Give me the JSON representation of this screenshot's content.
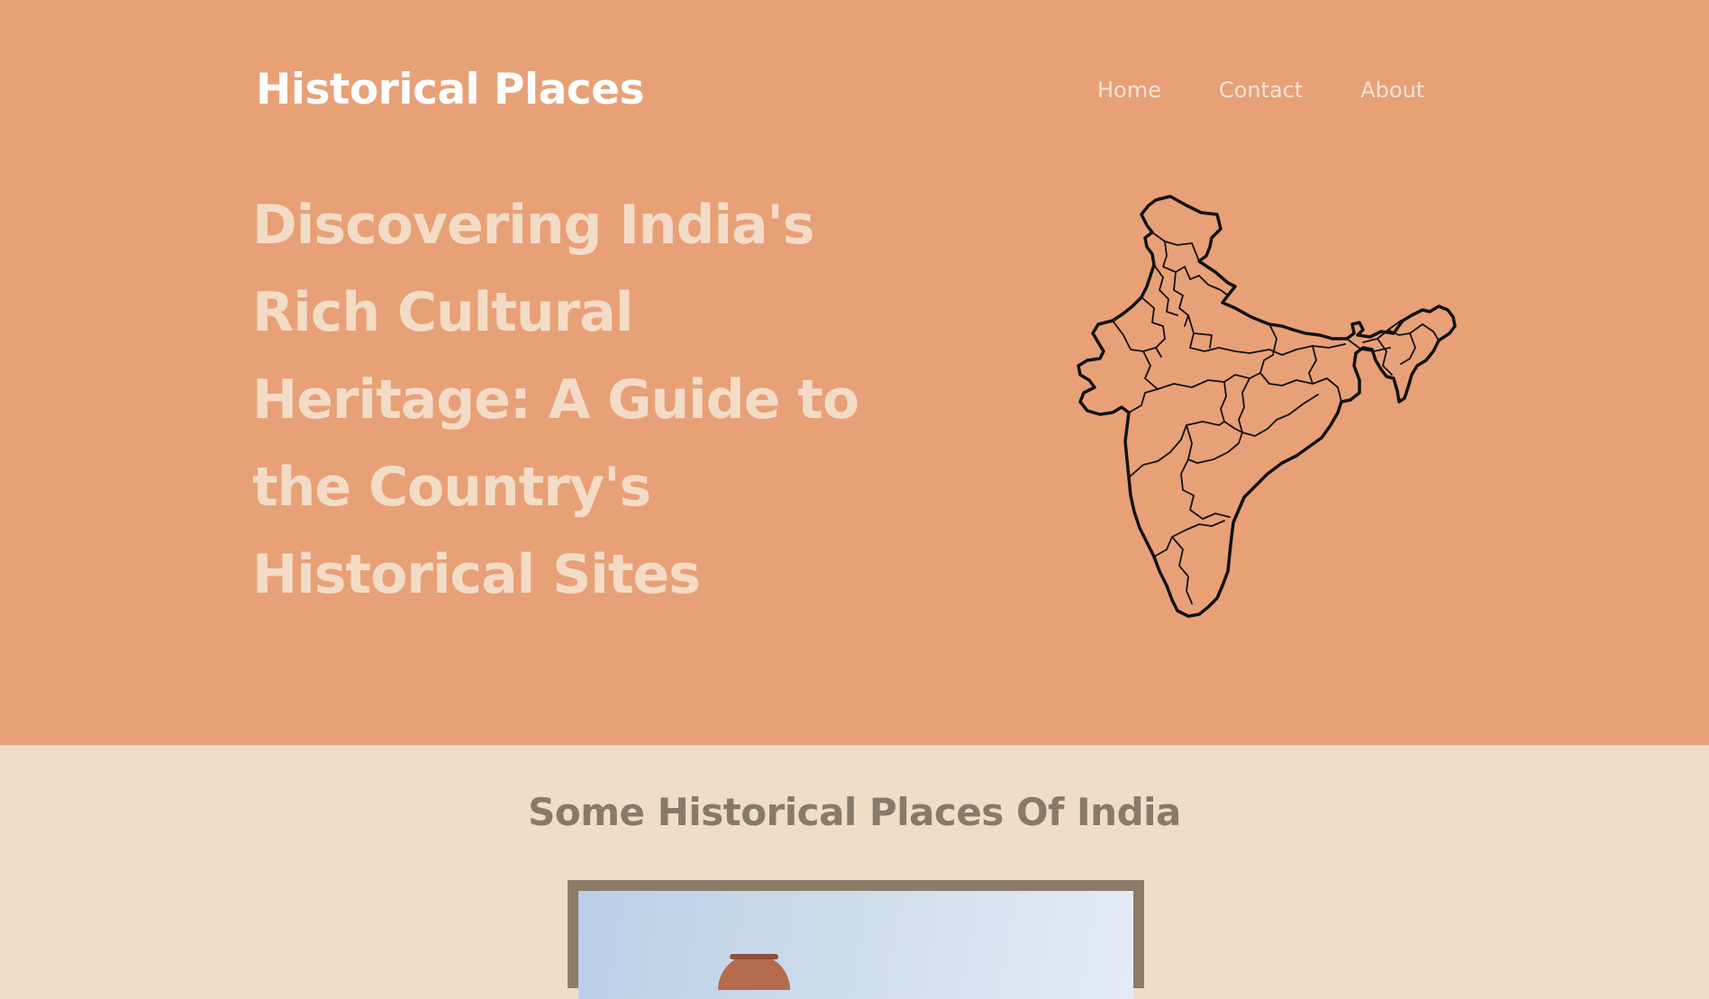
{
  "header": {
    "brand": "Historical Places",
    "nav": [
      {
        "label": "Home"
      },
      {
        "label": "Contact"
      },
      {
        "label": "About"
      }
    ]
  },
  "hero": {
    "headline": "Discovering India's Rich Cultural Heritage: A Guide to the Country's Historical Sites",
    "map_icon": "india-map-outline"
  },
  "section": {
    "title": "Some Historical Places Of India"
  },
  "colors": {
    "hero_background": "#e8a077",
    "section_background": "#f0ddc8",
    "headline": "#f3dcc7",
    "section_title": "#887a68",
    "card_frame": "#8c7b69"
  }
}
